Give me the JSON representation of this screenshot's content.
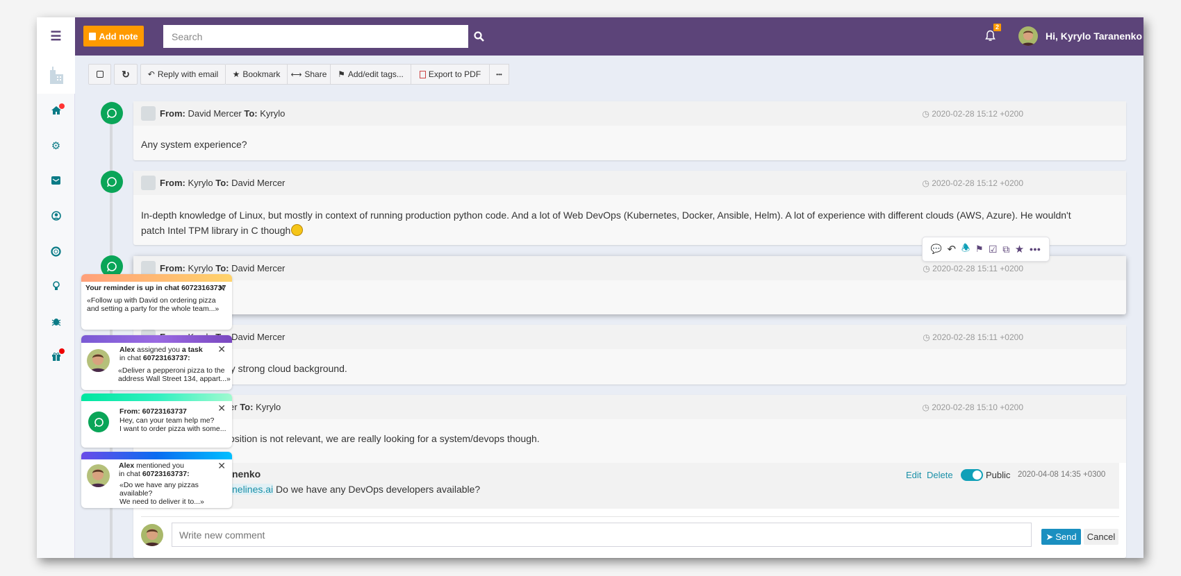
{
  "header": {
    "add_note": "Add note",
    "search_placeholder": "Search",
    "notification_count": "2",
    "greeting": "Hi, Kyrylo Taranenko"
  },
  "toolbar": {
    "reply": "Reply with email",
    "bookmark": "Bookmark",
    "share": "Share",
    "tags": "Add/edit tags...",
    "export": "Export to PDF",
    "more": "•••"
  },
  "labels": {
    "from": "From:",
    "to": "To:"
  },
  "messages": [
    {
      "from": "David Mercer",
      "to": "Kyrylo",
      "time": "2020-02-28 15:12 +0200",
      "body": "Any system experience?"
    },
    {
      "from": "Kyrylo",
      "to": "David Mercer",
      "time": "2020-02-28 15:12 +0200",
      "body": "In-depth knowledge of Linux, but mostly in context of running production python code. And a lot of Web DevOps (Kubernetes, Docker, Ansible, Helm). A lot of experience with different clouds (AWS, Azure). He wouldn't",
      "body2": "patch Intel TPM library in C though"
    },
    {
      "from": "Kyrylo",
      "to": "David Mercer",
      "time": "2020-02-28 15:11 +0200",
      "body": ""
    },
    {
      "from": "Kyrylo",
      "to": "David Mercer",
      "time": "2020-02-28 15:11 +0200",
      "body": "ry strong cloud background."
    },
    {
      "from_fragment": "er",
      "to": "Kyrylo",
      "time": "2020-02-28 15:10 +0200",
      "body": "osition is not relevant, we are really looking for a system/devops though."
    }
  ],
  "comment": {
    "author_fragment": "nenko",
    "mention_fragment": "nelines.ai",
    "text": "Do we have any DevOps developers available?",
    "edit": "Edit",
    "delete": "Delete",
    "visibility": "Public",
    "public_on": true,
    "time": "2020-04-08 14:35 +0300"
  },
  "new_comment": {
    "placeholder": "Write new comment",
    "send": "Send",
    "cancel": "Cancel"
  },
  "toasts": [
    {
      "title": "Your reminder is up in chat 60723163737",
      "line1": "«Follow up with David on ordering pizza",
      "line2": "and setting a party for the whole team...»"
    },
    {
      "actor": "Alex",
      "action": " assigned you ",
      "object": "a task",
      "chat_prefix": "in chat ",
      "chat": "60723163737:",
      "line1": "«Deliver a pepperoni pizza to the",
      "line2": "address Wall Street 134, appart...»"
    },
    {
      "title": "From: 60723163737",
      "line1": "Hey, can your team help me?",
      "line2": "I want to order pizza with some..."
    },
    {
      "actor": "Alex",
      "action": " mentioned you",
      "chat_prefix": "in chat ",
      "chat": "60723163737:",
      "line1": "«Do we have any pizzas available?",
      "line2": "We need to deliver it to...»"
    }
  ],
  "colors": {
    "header": "#5c4479",
    "accent": "#ff9a00",
    "whatsapp": "#0aa558",
    "teal": "#0b7b86",
    "send": "#1a8fc0"
  }
}
